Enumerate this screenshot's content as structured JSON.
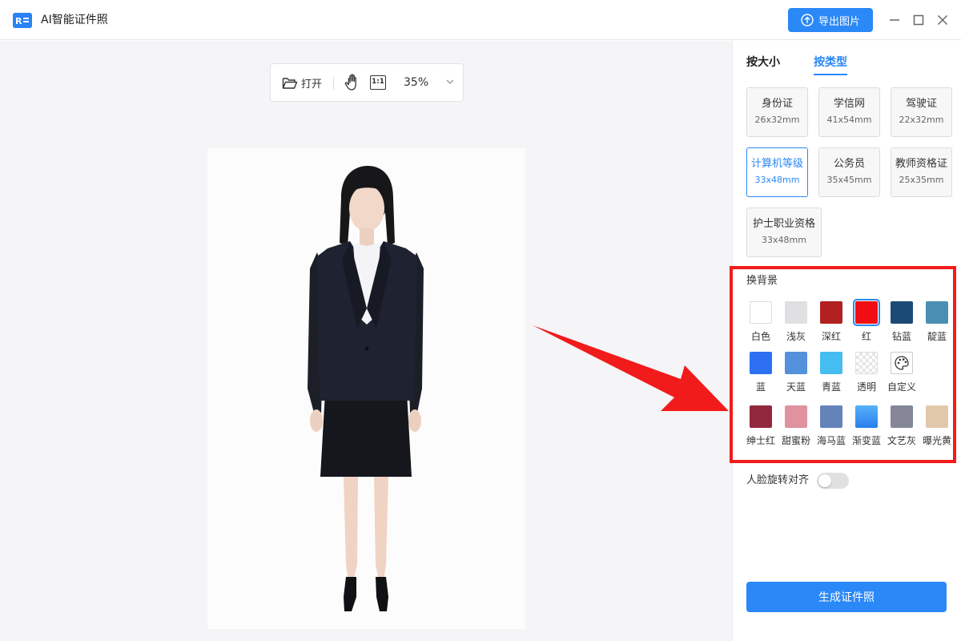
{
  "app": {
    "title": "AI智能证件照",
    "icon": "id-card-icon",
    "export_label": "导出图片",
    "accent": "#2a88f7"
  },
  "toolbar": {
    "open_label": "打开",
    "ratio_label": "1:1",
    "zoom": "35%"
  },
  "panel": {
    "tabs": [
      {
        "label": "按大小",
        "active": false
      },
      {
        "label": "按类型",
        "active": true
      }
    ],
    "types": [
      {
        "name": "身份证",
        "size": "26x32mm",
        "active": false
      },
      {
        "name": "学信网",
        "size": "41x54mm",
        "active": false
      },
      {
        "name": "驾驶证",
        "size": "22x32mm",
        "active": false
      },
      {
        "name": "计算机等级",
        "size": "33x48mm",
        "active": true
      },
      {
        "name": "公务员",
        "size": "35x45mm",
        "active": false
      },
      {
        "name": "教师资格证",
        "size": "25x35mm",
        "active": false
      },
      {
        "name": "护士职业资格",
        "size": "33x48mm",
        "active": false
      }
    ],
    "background": {
      "title": "换背景",
      "swatches": [
        {
          "label": "白色",
          "color": "#ffffff"
        },
        {
          "label": "浅灰",
          "color": "#e0e0e2"
        },
        {
          "label": "深红",
          "color": "#b0211f"
        },
        {
          "label": "红",
          "color": "#f20d12",
          "selected": true
        },
        {
          "label": "钻蓝",
          "color": "#1c4a76"
        },
        {
          "label": "靛蓝",
          "color": "#4a8fb3"
        },
        {
          "label": "蓝",
          "color": "#2d70f2"
        },
        {
          "label": "天蓝",
          "color": "#5391dd"
        },
        {
          "label": "青蓝",
          "color": "#45bdf1"
        },
        {
          "label": "透明",
          "color": "transparent"
        },
        {
          "label": "自定义",
          "color": "custom"
        },
        {
          "label": "绅士红",
          "color": "#92283e"
        },
        {
          "label": "甜蜜粉",
          "color": "#e0929e"
        },
        {
          "label": "海马蓝",
          "color": "#6383b9"
        },
        {
          "label": "渐变蓝",
          "color": "#3d9af2"
        },
        {
          "label": "文艺灰",
          "color": "#858799"
        },
        {
          "label": "曝光黄",
          "color": "#e2c8ab"
        }
      ]
    },
    "face_align_label": "人脸旋转对齐",
    "face_align_on": false,
    "generate_label": "生成证件照"
  }
}
